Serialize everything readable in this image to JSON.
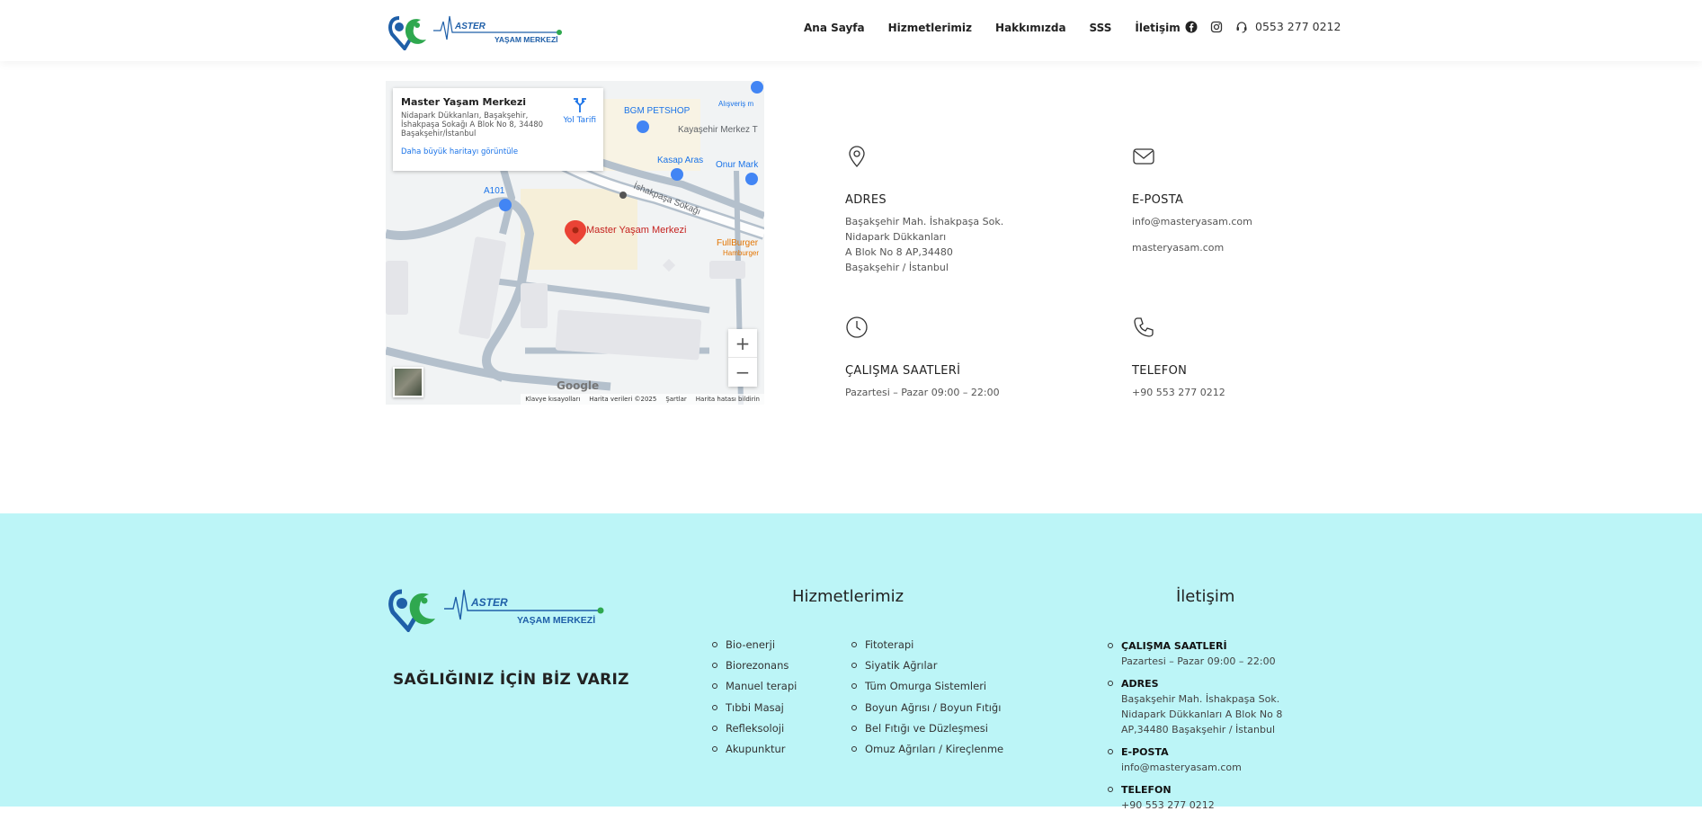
{
  "brand": {
    "logo_line1": "ASTER",
    "logo_line2": "YAŞAM MERKEZİ",
    "colors": {
      "blue": "#1f5fa8",
      "green": "#2fa84f",
      "footer_bg": "#bcf5f7"
    }
  },
  "nav": {
    "items": [
      "Ana Sayfa",
      "Hizmetlerimiz",
      "Hakkımızda",
      "SSS",
      "İletişim"
    ],
    "phone": "0553 277 0212",
    "icons": [
      "facebook-icon",
      "instagram-icon",
      "headset-icon"
    ]
  },
  "map": {
    "place_name": "Master Yaşam Merkezi",
    "address": "Nidapark Dükkanları, Başakşehir, İshakpaşa Sokağı A Blok No 8, 34480 Başakşehir/İstanbul",
    "larger_map_link": "Daha büyük haritayı görüntüle",
    "directions_label": "Yol Tarifi",
    "pin_label": "Master Yaşam Merkezi",
    "labels": {
      "petshop": "BGM PETSHOP",
      "kayasehir": "Kayaşehir Merkez T",
      "kasap": "Kasap Aras",
      "onur": "Onur Mark",
      "a101": "A101",
      "street": "İshakpaşa Sokağı",
      "fullburger": "FullBurger",
      "hamburger": "Hamburger",
      "alisveris": "Alışveriş m"
    },
    "google": "Google",
    "footer": [
      "Klavye kısayolları",
      "Harita verileri ©2025",
      "Şartlar",
      "Harita hatası bildirin"
    ],
    "zoom_in": "+",
    "zoom_out": "−"
  },
  "contact": {
    "address_title": "ADRES",
    "address_lines": [
      "Başakşehir Mah. İshakpaşa Sok.",
      "Nidapark Dükkanları",
      "A Blok No 8 AP,34480",
      "Başakşehir / İstanbul"
    ],
    "email_title": "E-POSTA",
    "email": "info@masteryasam.com",
    "website": "masteryasam.com",
    "hours_title": "ÇALIŞMA SAATLERİ",
    "hours": "Pazartesi – Pazar 09:00 – 22:00",
    "phone_title": "TELEFON",
    "phone": "+90 553 277 0212"
  },
  "footer": {
    "slogan": "SAĞLIĞINIZ İÇİN BİZ VARIZ",
    "services_heading": "Hizmetlerimiz",
    "services_col1": [
      "Bio-enerji",
      "Biorezonans",
      "Manuel terapi",
      "Tıbbi Masaj",
      "Refleksoloji",
      "Akupunktur"
    ],
    "services_col2": [
      "Fitoterapi",
      "Siyatik Ağrılar",
      "Tüm Omurga Sistemleri",
      "Boyun Ağrısı / Boyun Fıtığı",
      "Bel Fıtığı ve Düzleşmesi",
      "Omuz Ağrıları / Kireçlenme"
    ],
    "contact_heading": "İletişim",
    "contact_items": [
      {
        "title": "ÇALIŞMA SAATLERİ",
        "value": "Pazartesi – Pazar 09:00 – 22:00"
      },
      {
        "title": "ADRES",
        "value": "Başakşehir Mah. İshakpaşa Sok. Nidapark Dükkanları A Blok No 8 AP,34480 Başakşehir / İstanbul"
      },
      {
        "title": "E-POSTA",
        "value": "info@masteryasam.com"
      },
      {
        "title": "TELEFON",
        "value": "+90 553 277 0212"
      }
    ]
  }
}
